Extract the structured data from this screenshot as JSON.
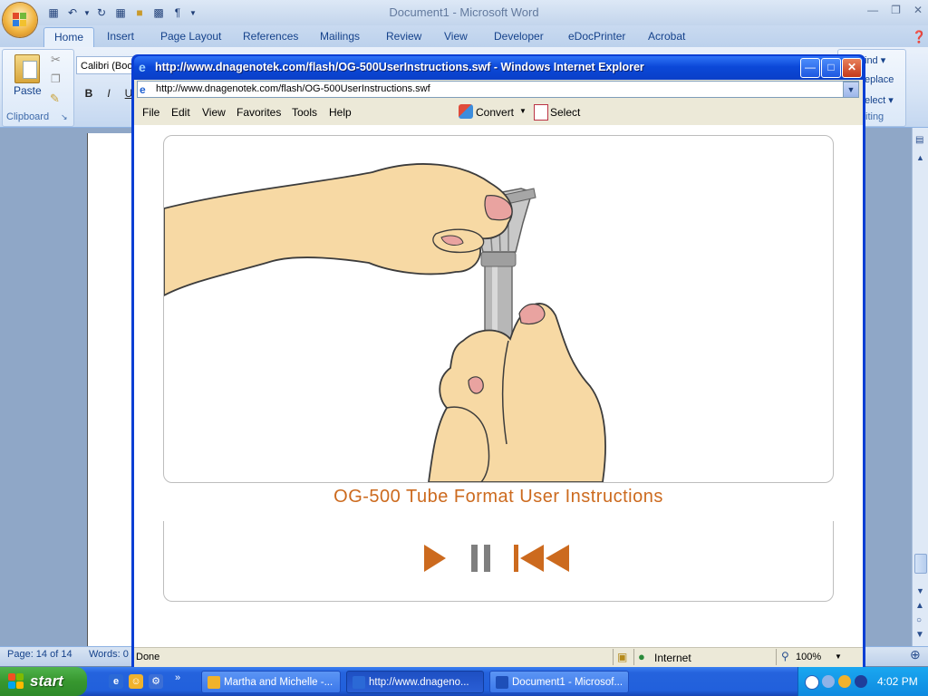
{
  "word": {
    "title": "Document1 - Microsoft Word",
    "tabs": [
      "Home",
      "Insert",
      "Page Layout",
      "References",
      "Mailings",
      "Review",
      "View",
      "Developer",
      "eDocPrinter",
      "Acrobat"
    ],
    "font_name": "Calibri (Boo",
    "paste_label": "Paste",
    "clipboard_label": "Clipboard",
    "format_buttons": [
      "B",
      "I",
      "U"
    ],
    "find_label": "ind",
    "replace_label": "eplace",
    "select_label": "elect",
    "editing_label": "iting",
    "status_page": "Page: 14 of 14",
    "status_words": "Words: 0"
  },
  "ie": {
    "title": "http://www.dnagenotek.com/flash/OG-500UserInstructions.swf - Windows Internet Explorer",
    "address": "http://www.dnagenotek.com/flash/OG-500UserInstructions.swf",
    "menus": [
      "File",
      "Edit",
      "View",
      "Favorites",
      "Tools",
      "Help"
    ],
    "convert_label": "Convert",
    "select_label": "Select",
    "status_text": "Done",
    "zone": "Internet",
    "zoom": "100%"
  },
  "flash": {
    "title": "OG-500 Tube Format User Instructions",
    "accent": "#cc6a1e"
  },
  "taskbar": {
    "start_label": "start",
    "tasks": [
      "Martha and Michelle -...",
      "http://www.dnageno...",
      "Document1 - Microsof..."
    ],
    "clock": "4:02 PM"
  }
}
